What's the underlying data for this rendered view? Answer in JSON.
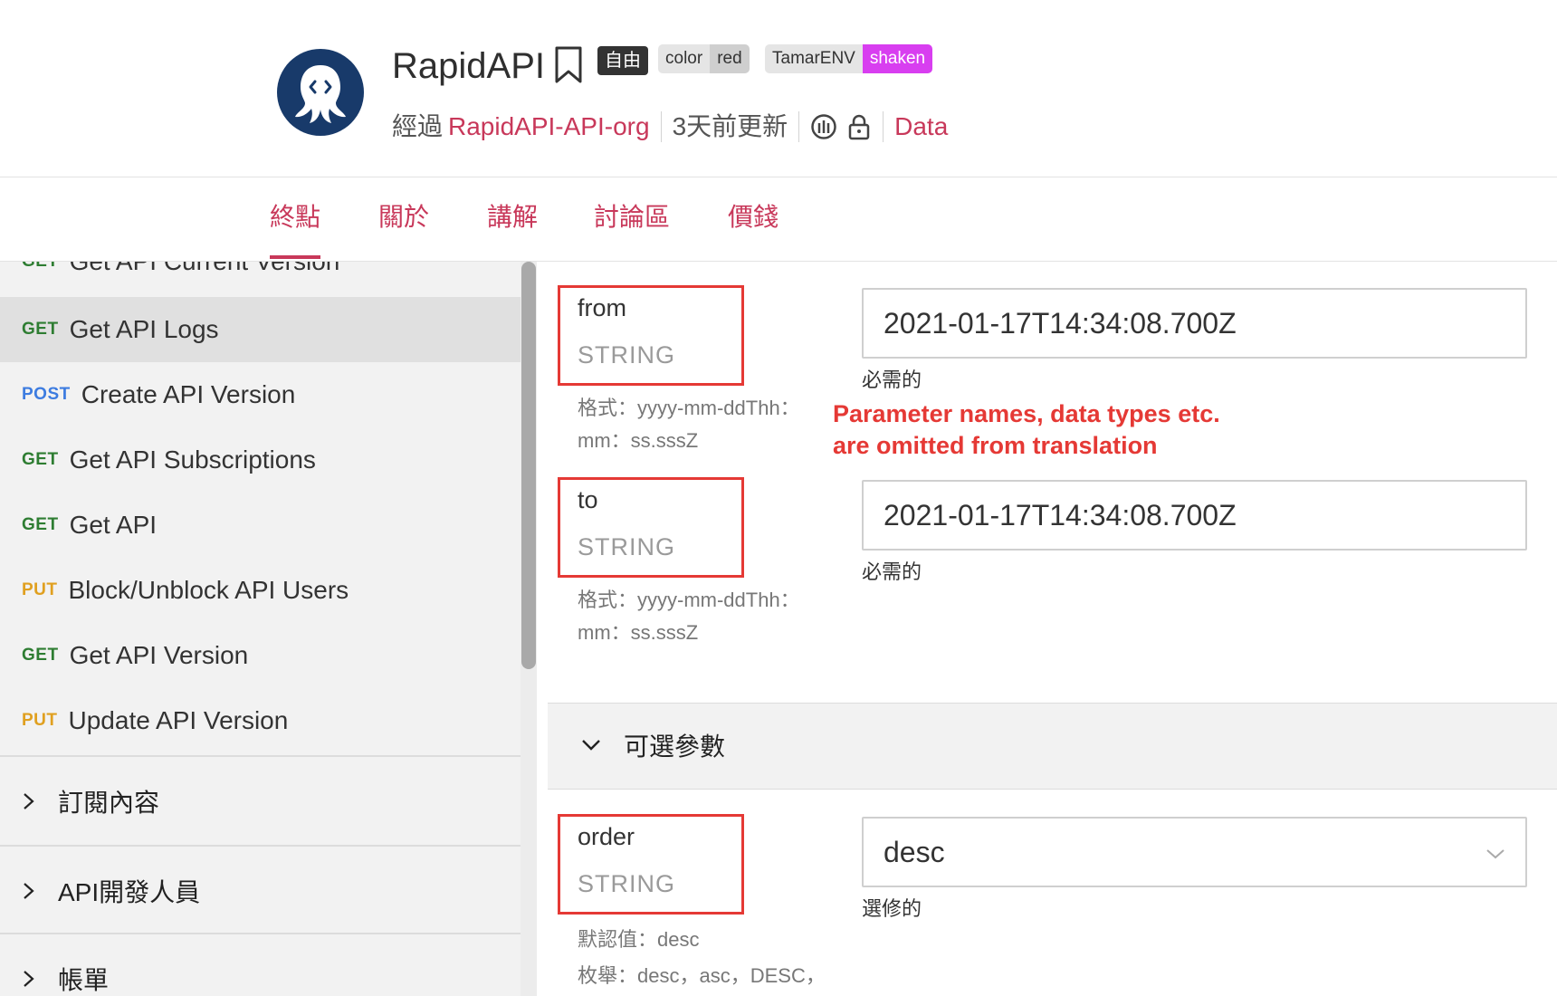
{
  "header": {
    "title": "RapidAPI",
    "tier_badge": "自由",
    "tags": [
      {
        "key": "color",
        "value": "red"
      },
      {
        "key": "TamarENV",
        "value": "shaken"
      }
    ],
    "by_prefix": "經過",
    "org": "RapidAPI-API-org",
    "updated": "3天前更新",
    "category": "Data"
  },
  "tabs": [
    {
      "label": "終點",
      "active": true
    },
    {
      "label": "關於",
      "active": false
    },
    {
      "label": "講解",
      "active": false
    },
    {
      "label": "討論區",
      "active": false
    },
    {
      "label": "價錢",
      "active": false
    }
  ],
  "sidebar": {
    "endpoints": [
      {
        "method": "GET",
        "name": "Get API Current Version"
      },
      {
        "method": "GET",
        "name": "Get API Logs",
        "active": true
      },
      {
        "method": "POST",
        "name": "Create API Version"
      },
      {
        "method": "GET",
        "name": "Get API Subscriptions"
      },
      {
        "method": "GET",
        "name": "Get API"
      },
      {
        "method": "PUT",
        "name": "Block/Unblock API Users"
      },
      {
        "method": "GET",
        "name": "Get API Version"
      },
      {
        "method": "PUT",
        "name": "Update API Version"
      }
    ],
    "sections": [
      {
        "label": "訂閱內容"
      },
      {
        "label": "API開發人員"
      },
      {
        "label": "帳單"
      }
    ]
  },
  "params": {
    "required": [
      {
        "name": "from",
        "type": "STRING",
        "desc_line1": "格式：yyyy-mm-ddThh：",
        "desc_line2": "mm：ss.sssZ",
        "value": "2021-01-17T14:34:08.700Z",
        "req_label": "必需的"
      },
      {
        "name": "to",
        "type": "STRING",
        "desc_line1": "格式：yyyy-mm-ddThh：",
        "desc_line2": "mm：ss.sssZ",
        "value": "2021-01-17T14:34:08.700Z",
        "req_label": "必需的"
      }
    ],
    "optional_header": "可選參數",
    "optional": [
      {
        "name": "order",
        "type": "STRING",
        "default_line": "默認值：desc",
        "enum_line": "枚舉：desc，asc，DESC，",
        "value": "desc",
        "req_label": "選修的"
      }
    ]
  },
  "annotation": {
    "line1": "Parameter names, data types etc.",
    "line2": "are omitted from translation"
  },
  "colors": {
    "accent": "#c8385a",
    "get": "#2e7d32",
    "post": "#3d7ce0",
    "put": "#e0a020",
    "annotation": "#e53935",
    "tag_highlight": "#d83ef0"
  }
}
